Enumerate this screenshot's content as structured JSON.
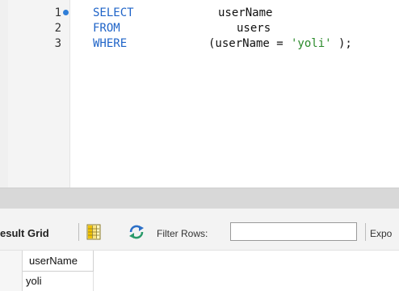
{
  "editor": {
    "lines": [
      {
        "number": "1",
        "tokens": [
          {
            "text": "SELECT",
            "kind": "keyword"
          },
          {
            "text": "userName",
            "kind": "identifier"
          }
        ],
        "has_marker": true
      },
      {
        "number": "2",
        "tokens": [
          {
            "text": "FROM",
            "kind": "keyword"
          },
          {
            "text": "users",
            "kind": "identifier"
          }
        ],
        "has_marker": false
      },
      {
        "number": "3",
        "tokens": [
          {
            "text": "WHERE",
            "kind": "keyword"
          },
          {
            "text": "(userName = ",
            "kind": "identifier"
          },
          {
            "text": "'yoli'",
            "kind": "string"
          },
          {
            "text": ");",
            "kind": "identifier"
          }
        ],
        "has_marker": false
      }
    ],
    "colors": {
      "keyword": "#1f64c8",
      "string": "#2a8a2a",
      "identifier": "#111111",
      "marker": "#2f7ed8"
    }
  },
  "result_toolbar": {
    "tab_label": "esult Grid",
    "grid_icon": "result-grid-icon",
    "refresh_icon": "refresh-icon",
    "filter_label": "Filter Rows:",
    "filter_value": "",
    "export_label": "Expo"
  },
  "result_grid": {
    "columns": [
      "userName"
    ],
    "rows": [
      [
        "yoli"
      ]
    ]
  }
}
